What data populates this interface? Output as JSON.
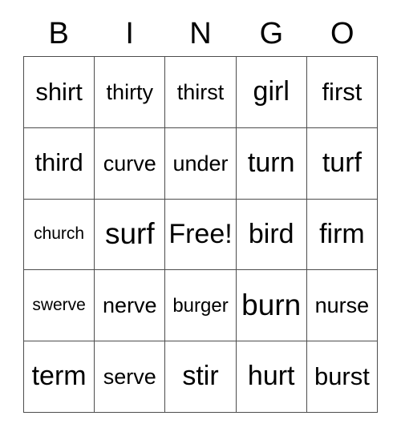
{
  "card": {
    "title": "BINGO",
    "header_letters": [
      "B",
      "I",
      "N",
      "G",
      "O"
    ],
    "free_space_label": "Free!",
    "text_color": "#000000",
    "border_color": "#4d4d4d",
    "background_color": "#ffffff",
    "rows": [
      [
        {
          "label": "shirt",
          "size": "lg"
        },
        {
          "label": "thirty",
          "size": "md"
        },
        {
          "label": "thirst",
          "size": "md"
        },
        {
          "label": "girl",
          "size": "xl"
        },
        {
          "label": "first",
          "size": "lg"
        }
      ],
      [
        {
          "label": "third",
          "size": "lg"
        },
        {
          "label": "curve",
          "size": "md"
        },
        {
          "label": "under",
          "size": "md"
        },
        {
          "label": "turn",
          "size": "xl"
        },
        {
          "label": "turf",
          "size": "xl"
        }
      ],
      [
        {
          "label": "church",
          "size": "xs"
        },
        {
          "label": "surf",
          "size": "xxl"
        },
        {
          "label": "Free!",
          "size": "xl"
        },
        {
          "label": "bird",
          "size": "xl"
        },
        {
          "label": "firm",
          "size": "xl"
        }
      ],
      [
        {
          "label": "swerve",
          "size": "xs"
        },
        {
          "label": "nerve",
          "size": "md"
        },
        {
          "label": "burger",
          "size": "sm"
        },
        {
          "label": "burn",
          "size": "xxl"
        },
        {
          "label": "nurse",
          "size": "md"
        }
      ],
      [
        {
          "label": "term",
          "size": "xl"
        },
        {
          "label": "serve",
          "size": "md"
        },
        {
          "label": "stir",
          "size": "xl"
        },
        {
          "label": "hurt",
          "size": "xl"
        },
        {
          "label": "burst",
          "size": "lg"
        }
      ]
    ]
  }
}
